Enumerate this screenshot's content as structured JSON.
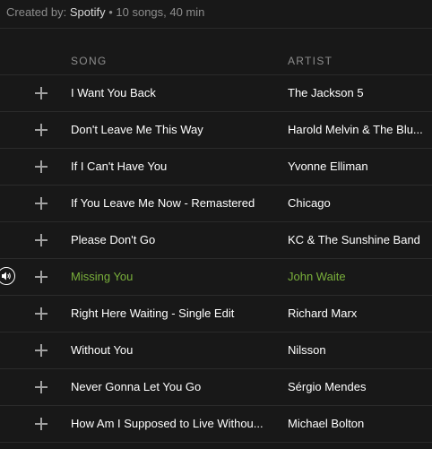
{
  "playlist": {
    "created_by_label": "Created by:",
    "creator": "Spotify",
    "separator": "•",
    "summary": "10 songs, 40 min"
  },
  "columns": {
    "song": "SONG",
    "artist": "ARTIST"
  },
  "tracks": [
    {
      "song": "I Want You Back",
      "artist": "The Jackson 5"
    },
    {
      "song": "Don't Leave Me This Way",
      "artist": "Harold Melvin & The Blu..."
    },
    {
      "song": "If I Can't Have You",
      "artist": "Yvonne Elliman"
    },
    {
      "song": "If You Leave Me Now - Remastered",
      "artist": "Chicago"
    },
    {
      "song": "Please Don't Go",
      "artist": "KC & The Sunshine Band"
    },
    {
      "song": "Missing You",
      "artist": "John Waite",
      "playing": true
    },
    {
      "song": "Right Here Waiting - Single Edit",
      "artist": "Richard Marx"
    },
    {
      "song": "Without You",
      "artist": "Nilsson"
    },
    {
      "song": "Never Gonna Let You Go",
      "artist": "Sérgio Mendes"
    },
    {
      "song": "How Am I Supposed to Live Withou...",
      "artist": "Michael Bolton"
    }
  ],
  "icons": {
    "add": "plus-icon",
    "now_playing": "speaker-icon"
  },
  "colors": {
    "background": "#181818",
    "playing_accent": "#7ab03b",
    "muted_text": "#8d8d8d",
    "divider": "#2b2b2b"
  }
}
